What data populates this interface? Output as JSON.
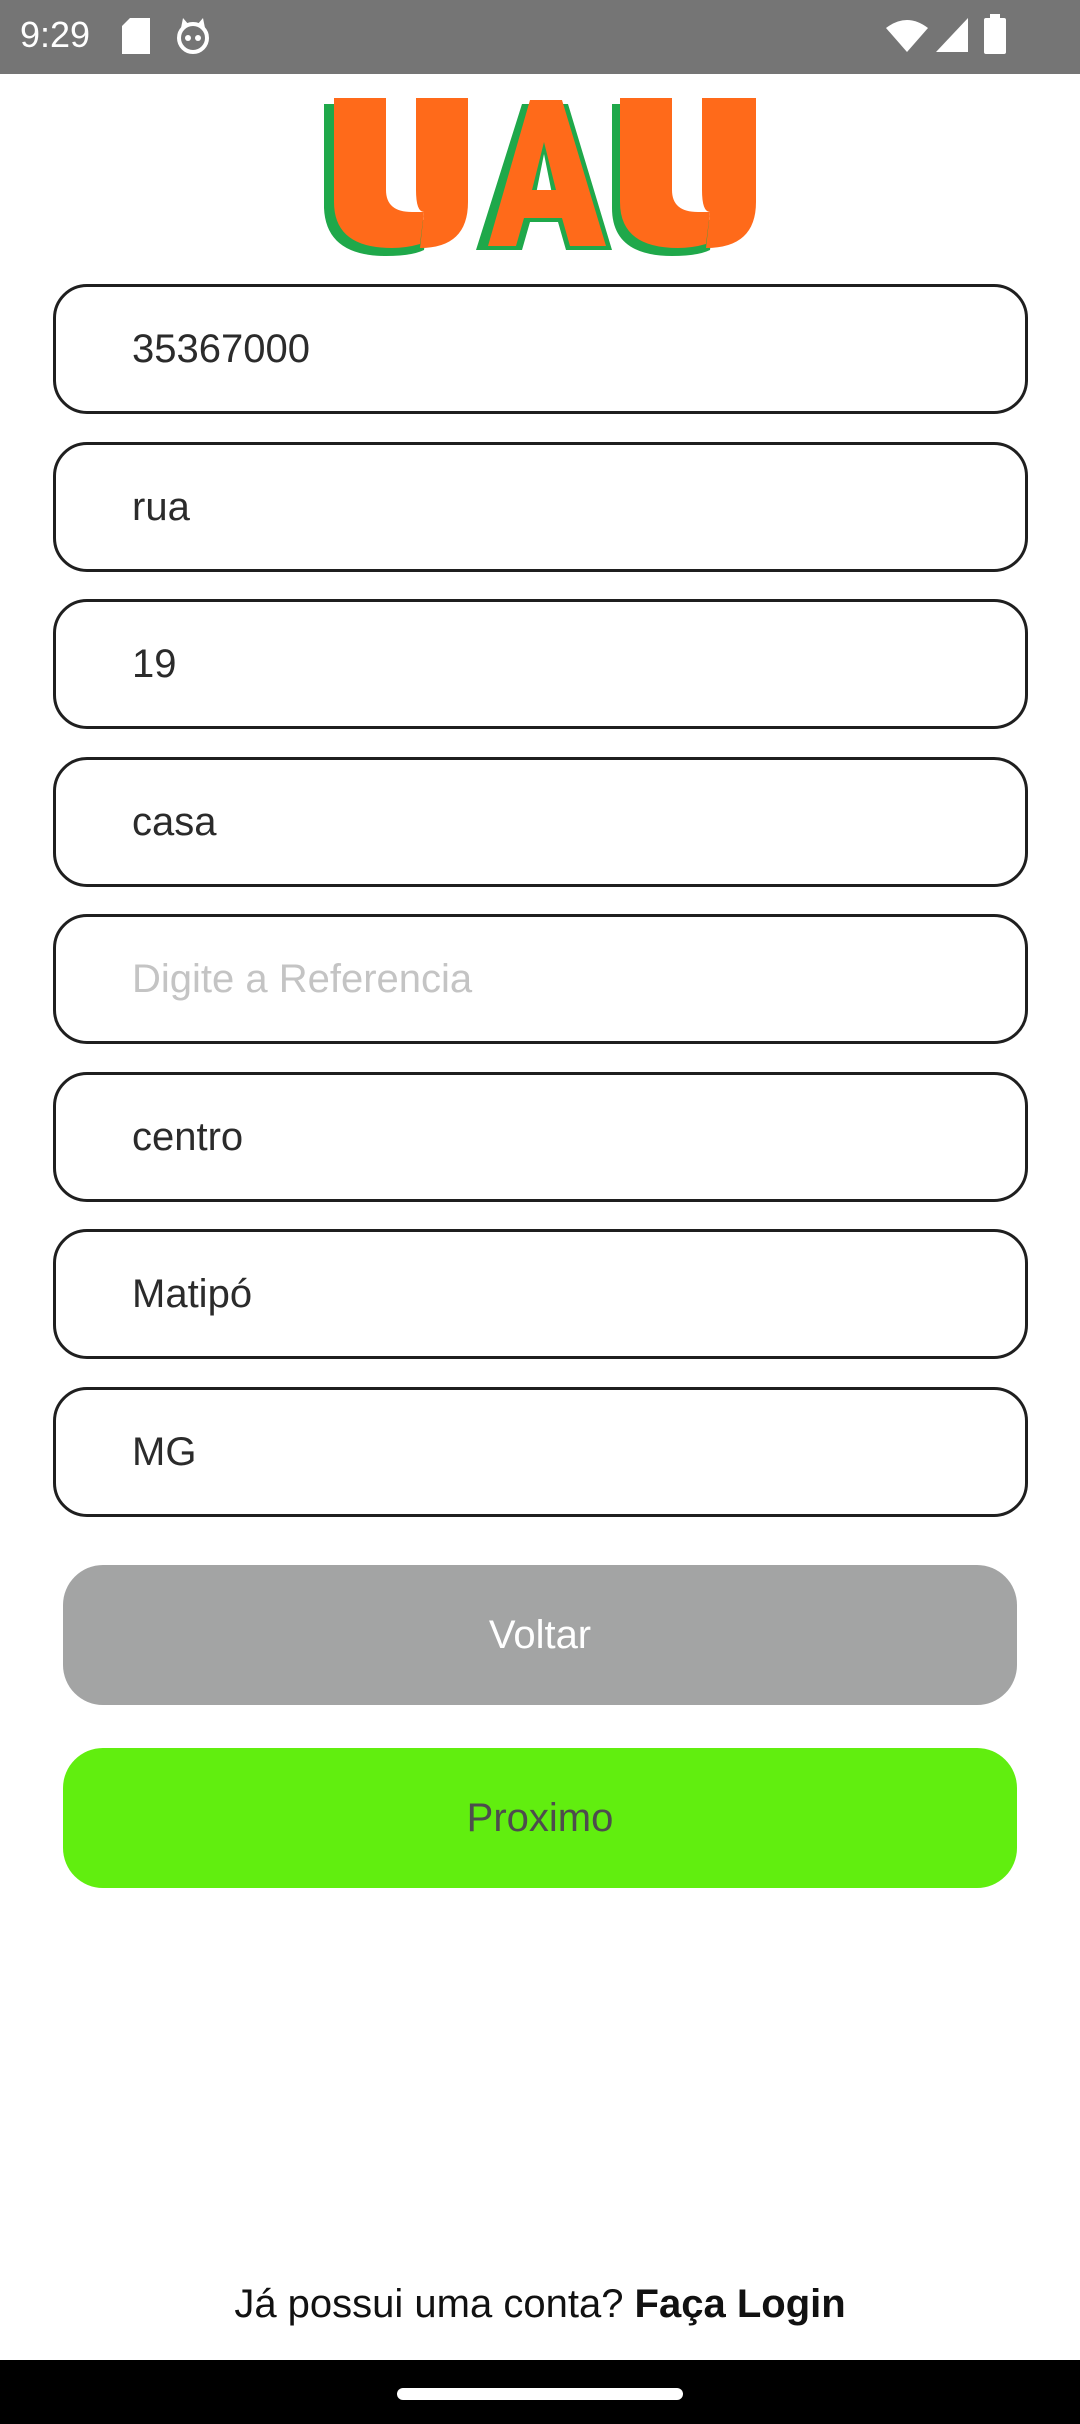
{
  "status_bar": {
    "time": "9:29",
    "icons": [
      "sd-card-icon",
      "cat-face-icon",
      "wifi-icon",
      "signal-icon",
      "battery-icon"
    ]
  },
  "logo": {
    "text": "UAU",
    "colors": {
      "orange": "#FF6A1A",
      "green": "#1FA84A"
    }
  },
  "form": {
    "fields": [
      {
        "name": "cep-input",
        "value": "35367000",
        "placeholder": ""
      },
      {
        "name": "street-input",
        "value": "rua",
        "placeholder": ""
      },
      {
        "name": "number-input",
        "value": "19",
        "placeholder": ""
      },
      {
        "name": "complement-input",
        "value": "casa",
        "placeholder": ""
      },
      {
        "name": "reference-input",
        "value": "",
        "placeholder": "Digite a Referencia"
      },
      {
        "name": "neighborhood-input",
        "value": "centro",
        "placeholder": ""
      },
      {
        "name": "city-input",
        "value": "Matipó",
        "placeholder": ""
      },
      {
        "name": "state-input",
        "value": "MG",
        "placeholder": ""
      }
    ]
  },
  "buttons": {
    "back_label": "Voltar",
    "next_label": "Proximo",
    "back_color": "#A3A4A4",
    "next_color": "#61EE0F"
  },
  "footer": {
    "question": "Já possui uma conta?",
    "login_link": "Faça Login"
  }
}
